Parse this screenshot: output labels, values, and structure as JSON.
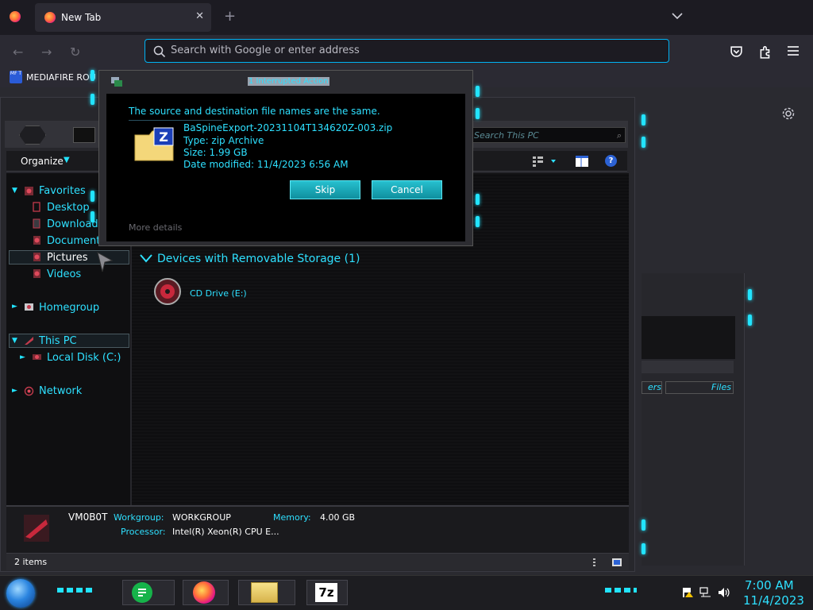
{
  "browser": {
    "tab_title": "New Tab",
    "address_placeholder": "Search with Google or enter address",
    "bookmark_icon_text": "MF T",
    "bookmark_label": "MEDIAFIRE ROU"
  },
  "explorer": {
    "search_placeholder": "Search This PC",
    "toolbar": {
      "organize": "Organize"
    },
    "nav": {
      "favorites": "Favorites",
      "desktop": "Desktop",
      "downloads": "Downloads",
      "documents": "Documents",
      "pictures": "Pictures",
      "videos": "Videos",
      "homegroup": "Homegroup",
      "this_pc": "This PC",
      "local_disk": "Local Disk (C:)",
      "network": "Network"
    },
    "content": {
      "group_header": "Devices with Removable Storage (1)",
      "cd_drive": "CD Drive (E:)"
    },
    "details": {
      "pc_name": "VM0B0T",
      "workgroup_label": "Workgroup:",
      "workgroup_value": "WORKGROUP",
      "memory_label": "Memory:",
      "memory_value": "4.00 GB",
      "processor_label": "Processor:",
      "processor_value": "Intel(R) Xeon(R) CPU E..."
    },
    "status": "2 items"
  },
  "bg_window": {
    "col1": "ers",
    "col2": "Files"
  },
  "dialog": {
    "title": "1 Interrupted Action",
    "message": "The source and destination file names are the same.",
    "file_name": "BaSpineExport-20231104T134620Z-003.zip",
    "file_type": "Type: zip Archive",
    "file_size": "Size: 1.99 GB",
    "file_date": "Date modified: 11/4/2023 6:56 AM",
    "skip": "Skip",
    "cancel": "Cancel",
    "more_details": "More details"
  },
  "taskbar": {
    "sevenzip_label": "7z",
    "time": "7:00 AM",
    "date": "11/4/2023"
  },
  "colors": {
    "accent": "#2ee0ff",
    "led": "#22e4ff",
    "url_focus": "#00b3f4"
  }
}
